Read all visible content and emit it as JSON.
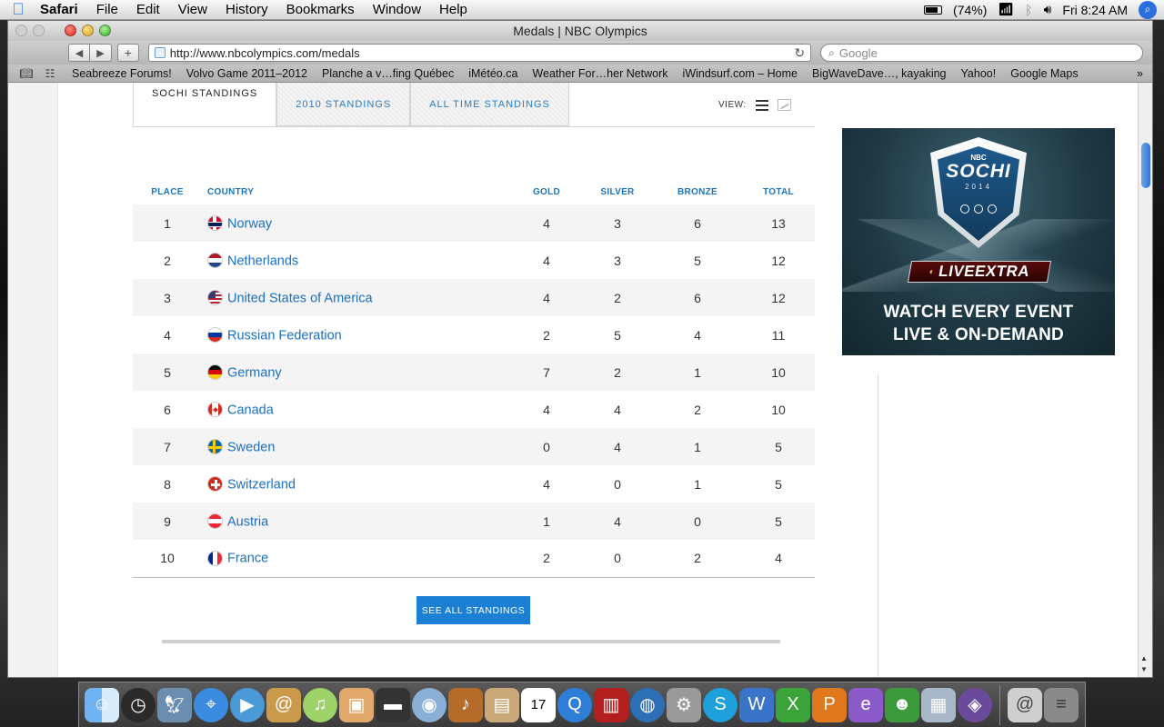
{
  "menubar": {
    "app": "Safari",
    "items": [
      "File",
      "Edit",
      "View",
      "History",
      "Bookmarks",
      "Window",
      "Help"
    ],
    "battery": "(74%)",
    "clock": "Fri 8:24 AM"
  },
  "window": {
    "title": "Medals | NBC Olympics",
    "url": "http://www.nbcolympics.com/medals",
    "search_placeholder": "Google"
  },
  "bookmarks": [
    "Seabreeze Forums!",
    "Volvo Game 2011–2012",
    "Planche a v…fing Québec",
    "iMétéo.ca",
    "Weather For…her Network",
    "iWindsurf.com – Home",
    "BigWaveDave…, kayaking",
    "Yahoo!",
    "Google Maps"
  ],
  "tabs": [
    "SOCHI STANDINGS",
    "2010 STANDINGS",
    "ALL TIME STANDINGS"
  ],
  "view_label": "VIEW:",
  "table": {
    "headers": {
      "place": "PLACE",
      "country": "COUNTRY",
      "gold": "GOLD",
      "silver": "SILVER",
      "bronze": "BRONZE",
      "total": "TOTAL"
    },
    "rows": [
      {
        "place": "1",
        "country": "Norway",
        "flag": "norway",
        "gold": "4",
        "silver": "3",
        "bronze": "6",
        "total": "13"
      },
      {
        "place": "2",
        "country": "Netherlands",
        "flag": "netherlands",
        "gold": "4",
        "silver": "3",
        "bronze": "5",
        "total": "12"
      },
      {
        "place": "3",
        "country": "United States of America",
        "flag": "usa",
        "gold": "4",
        "silver": "2",
        "bronze": "6",
        "total": "12"
      },
      {
        "place": "4",
        "country": "Russian Federation",
        "flag": "russia",
        "gold": "2",
        "silver": "5",
        "bronze": "4",
        "total": "11"
      },
      {
        "place": "5",
        "country": "Germany",
        "flag": "germany",
        "gold": "7",
        "silver": "2",
        "bronze": "1",
        "total": "10"
      },
      {
        "place": "6",
        "country": "Canada",
        "flag": "canada",
        "gold": "4",
        "silver": "4",
        "bronze": "2",
        "total": "10"
      },
      {
        "place": "7",
        "country": "Sweden",
        "flag": "sweden",
        "gold": "0",
        "silver": "4",
        "bronze": "1",
        "total": "5"
      },
      {
        "place": "8",
        "country": "Switzerland",
        "flag": "switzerland",
        "gold": "4",
        "silver": "0",
        "bronze": "1",
        "total": "5"
      },
      {
        "place": "9",
        "country": "Austria",
        "flag": "austria",
        "gold": "1",
        "silver": "4",
        "bronze": "0",
        "total": "5"
      },
      {
        "place": "10",
        "country": "France",
        "flag": "france",
        "gold": "2",
        "silver": "0",
        "bronze": "2",
        "total": "4"
      }
    ]
  },
  "see_all_label": "SEE ALL STANDINGS",
  "ad": {
    "network": "NBC",
    "brand": "SOCHI",
    "year": "2014",
    "live_extra": "LIVEEXTRA",
    "tagline_1": "WATCH EVERY EVENT",
    "tagline_2": "LIVE & ON-DEMAND"
  },
  "colors": {
    "link": "#1b6fbf",
    "accent": "#1b7fd4",
    "header": "#1b75bc"
  }
}
